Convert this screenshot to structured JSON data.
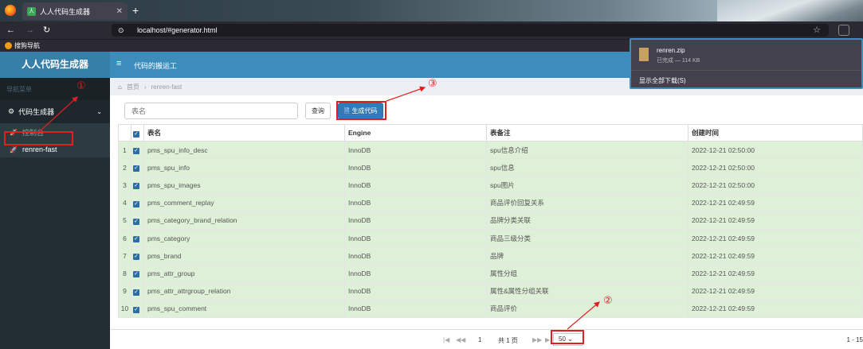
{
  "browser": {
    "tab_title": "人人代码生成器",
    "tab_favicon": "人",
    "url": "localhost/#generator.html",
    "bookmark": "搜狗导航"
  },
  "sidebar": {
    "logo": "人人代码生成器",
    "menu_header": "导航菜单",
    "group": "代码生成器",
    "items": [
      {
        "label": "控制台"
      },
      {
        "label": "renren-fast"
      }
    ]
  },
  "topbar": {
    "title": "代码的搬运工"
  },
  "breadcrumb": {
    "home": "首页",
    "current": "renren-fast"
  },
  "toolbar": {
    "search_placeholder": "表名",
    "query_label": "查询",
    "generate_label": "生成代码"
  },
  "table": {
    "headers": [
      "表名",
      "Engine",
      "表备注",
      "创建时间"
    ],
    "rows": [
      {
        "n": "1",
        "name": "pms_spu_info_desc",
        "engine": "InnoDB",
        "comment": "spu信息介绍",
        "time": "2022-12-21 02:50:00"
      },
      {
        "n": "2",
        "name": "pms_spu_info",
        "engine": "InnoDB",
        "comment": "spu信息",
        "time": "2022-12-21 02:50:00"
      },
      {
        "n": "3",
        "name": "pms_spu_images",
        "engine": "InnoDB",
        "comment": "spu图片",
        "time": "2022-12-21 02:50:00"
      },
      {
        "n": "4",
        "name": "pms_comment_replay",
        "engine": "InnoDB",
        "comment": "商品评价回复关系",
        "time": "2022-12-21 02:49:59"
      },
      {
        "n": "5",
        "name": "pms_category_brand_relation",
        "engine": "InnoDB",
        "comment": "品牌分类关联",
        "time": "2022-12-21 02:49:59"
      },
      {
        "n": "6",
        "name": "pms_category",
        "engine": "InnoDB",
        "comment": "商品三级分类",
        "time": "2022-12-21 02:49:59"
      },
      {
        "n": "7",
        "name": "pms_brand",
        "engine": "InnoDB",
        "comment": "品牌",
        "time": "2022-12-21 02:49:59"
      },
      {
        "n": "8",
        "name": "pms_attr_group",
        "engine": "InnoDB",
        "comment": "属性分组",
        "time": "2022-12-21 02:49:59"
      },
      {
        "n": "9",
        "name": "pms_attr_attrgroup_relation",
        "engine": "InnoDB",
        "comment": "属性&属性分组关联",
        "time": "2022-12-21 02:49:59"
      },
      {
        "n": "10",
        "name": "pms_spu_comment",
        "engine": "InnoDB",
        "comment": "商品评价",
        "time": "2022-12-21 02:49:59"
      }
    ]
  },
  "pager": {
    "page": "1",
    "total": "共 1 页",
    "size": "50",
    "range": "1 - 15"
  },
  "download": {
    "file": "renren.zip",
    "status": "已完成 — 114 KB",
    "show_all": "显示全部下载(S)"
  },
  "annotations": [
    "①",
    "②",
    "③"
  ],
  "colors": {
    "sidebar": "#222d32",
    "header": "#3c8dbc",
    "selected_row": "#dff0d8",
    "annotation": "#e02020"
  }
}
